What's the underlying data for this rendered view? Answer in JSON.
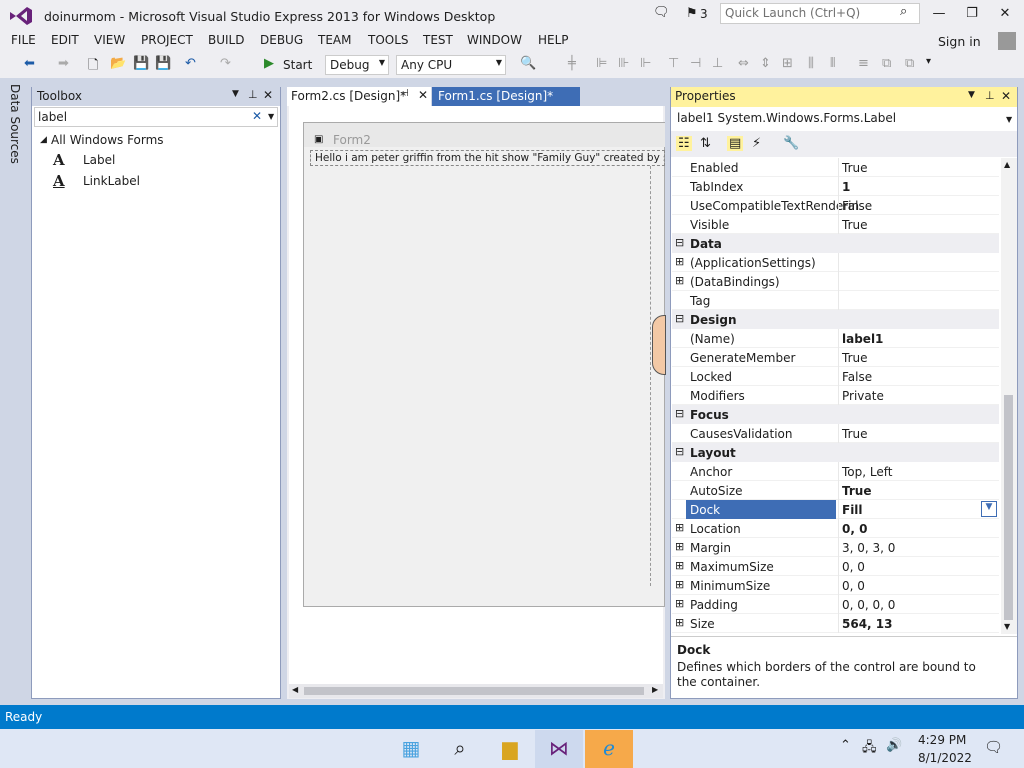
{
  "window": {
    "title": "doinurmom - Microsoft Visual Studio Express 2013 for Windows Desktop",
    "notifications": "3",
    "quick_launch_placeholder": "Quick Launch (Ctrl+Q)"
  },
  "menu": [
    "FILE",
    "EDIT",
    "VIEW",
    "PROJECT",
    "BUILD",
    "DEBUG",
    "TEAM",
    "TOOLS",
    "TEST",
    "WINDOW",
    "HELP"
  ],
  "signin": "Sign in",
  "toolbar": {
    "start_label": "Start",
    "config": "Debug",
    "platform": "Any CPU"
  },
  "data_sources": "Data Sources",
  "toolbox": {
    "title": "Toolbox",
    "search_value": "label",
    "group": "All Windows Forms",
    "items": [
      "Label",
      "LinkLabel"
    ]
  },
  "tabs": [
    "Form2.cs [Design]*",
    "Form1.cs [Design]*"
  ],
  "form": {
    "caption": "Form2",
    "label_text": "Hello i am peter griffin from the hit show \"Family Guy\" created by seth macfarlane"
  },
  "properties": {
    "title": "Properties",
    "object": "label1 System.Windows.Forms.Label",
    "rows": [
      {
        "kind": "row",
        "name": "Enabled",
        "value": "True"
      },
      {
        "kind": "row",
        "name": "TabIndex",
        "value": "1",
        "bold": true
      },
      {
        "kind": "row",
        "name": "UseCompatibleTextRenderin",
        "value": "False"
      },
      {
        "kind": "row",
        "name": "Visible",
        "value": "True"
      },
      {
        "kind": "cat",
        "name": "Data"
      },
      {
        "kind": "row",
        "name": "(ApplicationSettings)",
        "value": "",
        "expand": true
      },
      {
        "kind": "row",
        "name": "(DataBindings)",
        "value": "",
        "expand": true
      },
      {
        "kind": "row",
        "name": "Tag",
        "value": ""
      },
      {
        "kind": "cat",
        "name": "Design"
      },
      {
        "kind": "row",
        "name": "(Name)",
        "value": "label1",
        "bold": true
      },
      {
        "kind": "row",
        "name": "GenerateMember",
        "value": "True"
      },
      {
        "kind": "row",
        "name": "Locked",
        "value": "False"
      },
      {
        "kind": "row",
        "name": "Modifiers",
        "value": "Private"
      },
      {
        "kind": "cat",
        "name": "Focus"
      },
      {
        "kind": "row",
        "name": "CausesValidation",
        "value": "True"
      },
      {
        "kind": "cat",
        "name": "Layout"
      },
      {
        "kind": "row",
        "name": "Anchor",
        "value": "Top, Left"
      },
      {
        "kind": "row",
        "name": "AutoSize",
        "value": "True",
        "bold": true
      },
      {
        "kind": "row",
        "name": "Dock",
        "value": "Fill",
        "bold": true,
        "selected": true
      },
      {
        "kind": "row",
        "name": "Location",
        "value": "0, 0",
        "bold": true,
        "expand": true
      },
      {
        "kind": "row",
        "name": "Margin",
        "value": "3, 0, 3, 0",
        "expand": true
      },
      {
        "kind": "row",
        "name": "MaximumSize",
        "value": "0, 0",
        "expand": true
      },
      {
        "kind": "row",
        "name": "MinimumSize",
        "value": "0, 0",
        "expand": true
      },
      {
        "kind": "row",
        "name": "Padding",
        "value": "0, 0, 0, 0",
        "expand": true
      },
      {
        "kind": "row",
        "name": "Size",
        "value": "564, 13",
        "bold": true,
        "expand": true
      }
    ],
    "desc_title": "Dock",
    "desc_text": "Defines which borders of the control are bound to the container."
  },
  "status": "Ready",
  "clock": {
    "time": "4:29 PM",
    "date": "8/1/2022"
  },
  "colors": {
    "accent": "#007acc",
    "selection": "#3e6db5",
    "vs_purple": "#68217a"
  }
}
